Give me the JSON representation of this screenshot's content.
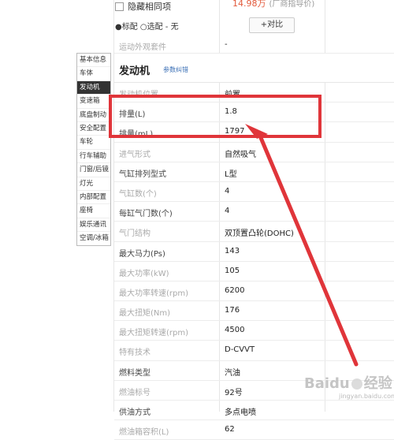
{
  "header": {
    "price_text": "14.98万",
    "price_note": "(厂商指导价)",
    "hide_same_label": "隐藏相同项",
    "legend_text": "●标配 ○选配 - 无",
    "compare_button": "+对比"
  },
  "prev_row": {
    "label": "运动外观套件",
    "value": "-"
  },
  "sidebar": {
    "items": [
      {
        "label": "基本信息"
      },
      {
        "label": "车体"
      },
      {
        "label": "发动机",
        "active": true
      },
      {
        "label": "变速箱"
      },
      {
        "label": "底盘制动"
      },
      {
        "label": "安全配置"
      },
      {
        "label": "车轮"
      },
      {
        "label": "行车辅助"
      },
      {
        "label": "门窗/后镜"
      },
      {
        "label": "灯光"
      },
      {
        "label": "内部配置"
      },
      {
        "label": "座椅"
      },
      {
        "label": "娱乐通讯"
      },
      {
        "label": "空调/冰箱"
      }
    ]
  },
  "section": {
    "title": "发动机",
    "hint": "参数纠错"
  },
  "rows": [
    {
      "label": "发动机位置",
      "value": "前置"
    },
    {
      "label": "排量(L)",
      "value": "1.8"
    },
    {
      "label": "排量(mL)",
      "value": "1797"
    },
    {
      "label": "进气形式",
      "value": "自然吸气"
    },
    {
      "label": "气缸排列型式",
      "value": "L型"
    },
    {
      "label": "气缸数(个)",
      "value": "4"
    },
    {
      "label": "每缸气门数(个)",
      "value": "4"
    },
    {
      "label": "气门结构",
      "value": "双顶置凸轮(DOHC)"
    },
    {
      "label": "最大马力(Ps)",
      "value": "143"
    },
    {
      "label": "最大功率(kW)",
      "value": "105"
    },
    {
      "label": "最大功率转速(rpm)",
      "value": "6200"
    },
    {
      "label": "最大扭矩(Nm)",
      "value": "176"
    },
    {
      "label": "最大扭矩转速(rpm)",
      "value": "4500"
    },
    {
      "label": "特有技术",
      "value": "D-CVVT"
    },
    {
      "label": "燃料类型",
      "value": "汽油"
    },
    {
      "label": "燃油标号",
      "value": "92号"
    },
    {
      "label": "供油方式",
      "value": "多点电喷"
    },
    {
      "label": "燃油箱容积(L)",
      "value": "62"
    }
  ],
  "watermark": {
    "brand": "Baidu",
    "product": "经验",
    "url": "jingyan.baidu.com"
  },
  "colors": {
    "highlight": "#e0353a",
    "active_nav": "#333333",
    "price": "#e25a3c"
  }
}
